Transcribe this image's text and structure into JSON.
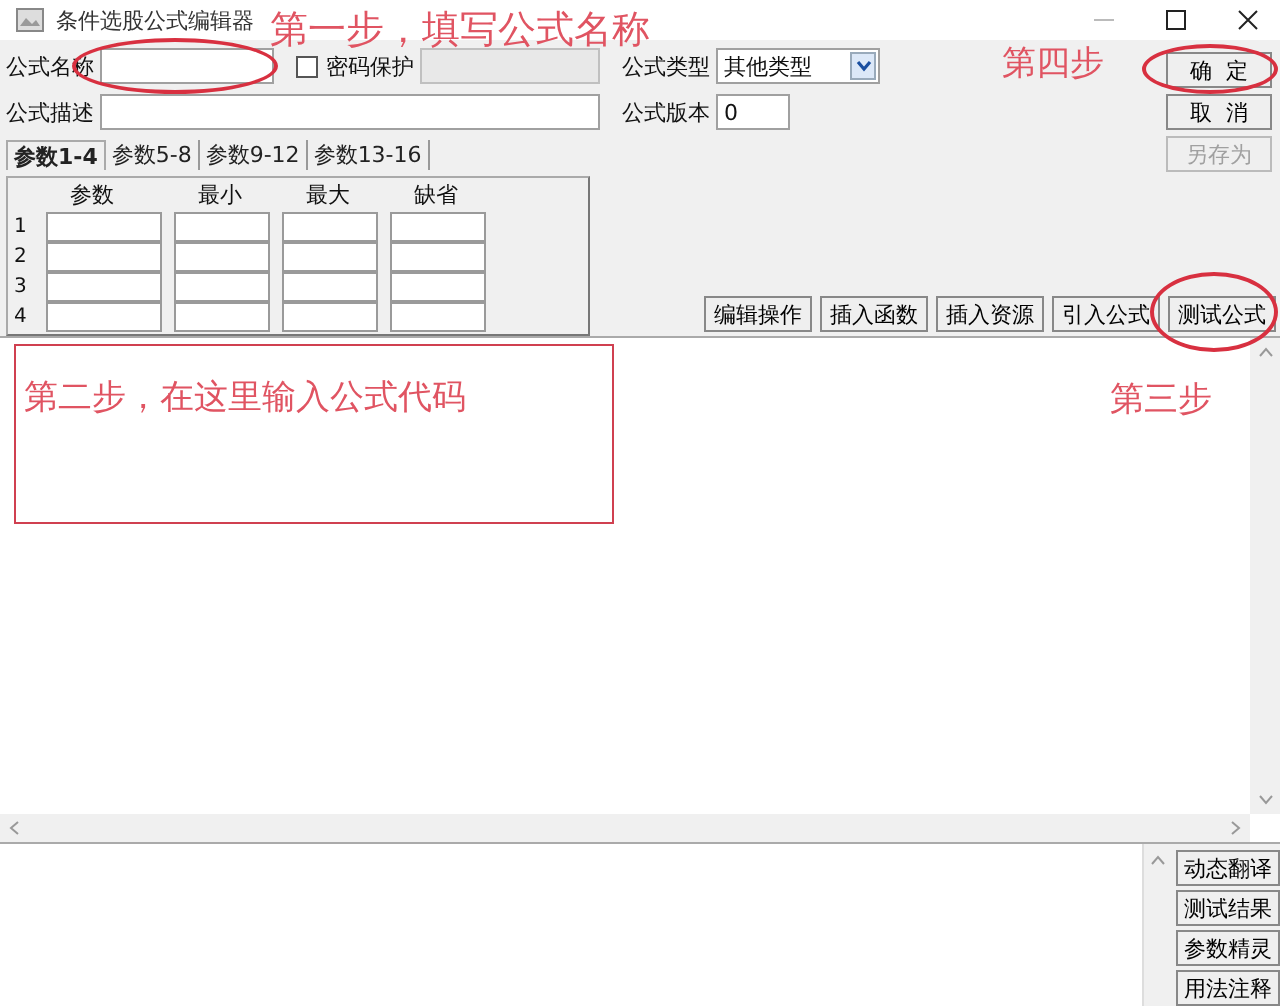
{
  "window": {
    "title": "条件选股公式编辑器"
  },
  "form": {
    "name_label": "公式名称",
    "password": {
      "label": "密码保护",
      "checked": false
    },
    "type_label": "公式类型",
    "type_value": "其他类型",
    "desc_label": "公式描述",
    "version_label": "公式版本",
    "version_value": "0"
  },
  "tabs": [
    {
      "label": "参数1-4",
      "selected": true
    },
    {
      "label": "参数5-8",
      "selected": false
    },
    {
      "label": "参数9-12",
      "selected": false
    },
    {
      "label": "参数13-16",
      "selected": false
    }
  ],
  "params": {
    "columns": [
      "参数",
      "最小",
      "最大",
      "缺省"
    ],
    "rows": [
      "1",
      "2",
      "3",
      "4"
    ]
  },
  "actions": [
    "编辑操作",
    "插入函数",
    "插入资源",
    "引入公式",
    "测试公式"
  ],
  "dialog_buttons": [
    {
      "label": "确  定",
      "disabled": false
    },
    {
      "label": "取  消",
      "disabled": false
    },
    {
      "label": "另存为",
      "disabled": true
    }
  ],
  "side_buttons": [
    "动态翻译",
    "测试结果",
    "参数精灵",
    "用法注释"
  ],
  "annotations": [
    "第一步，填写公式名称",
    "第二步，在这里输入公式代码",
    "第三步",
    "第四步"
  ]
}
